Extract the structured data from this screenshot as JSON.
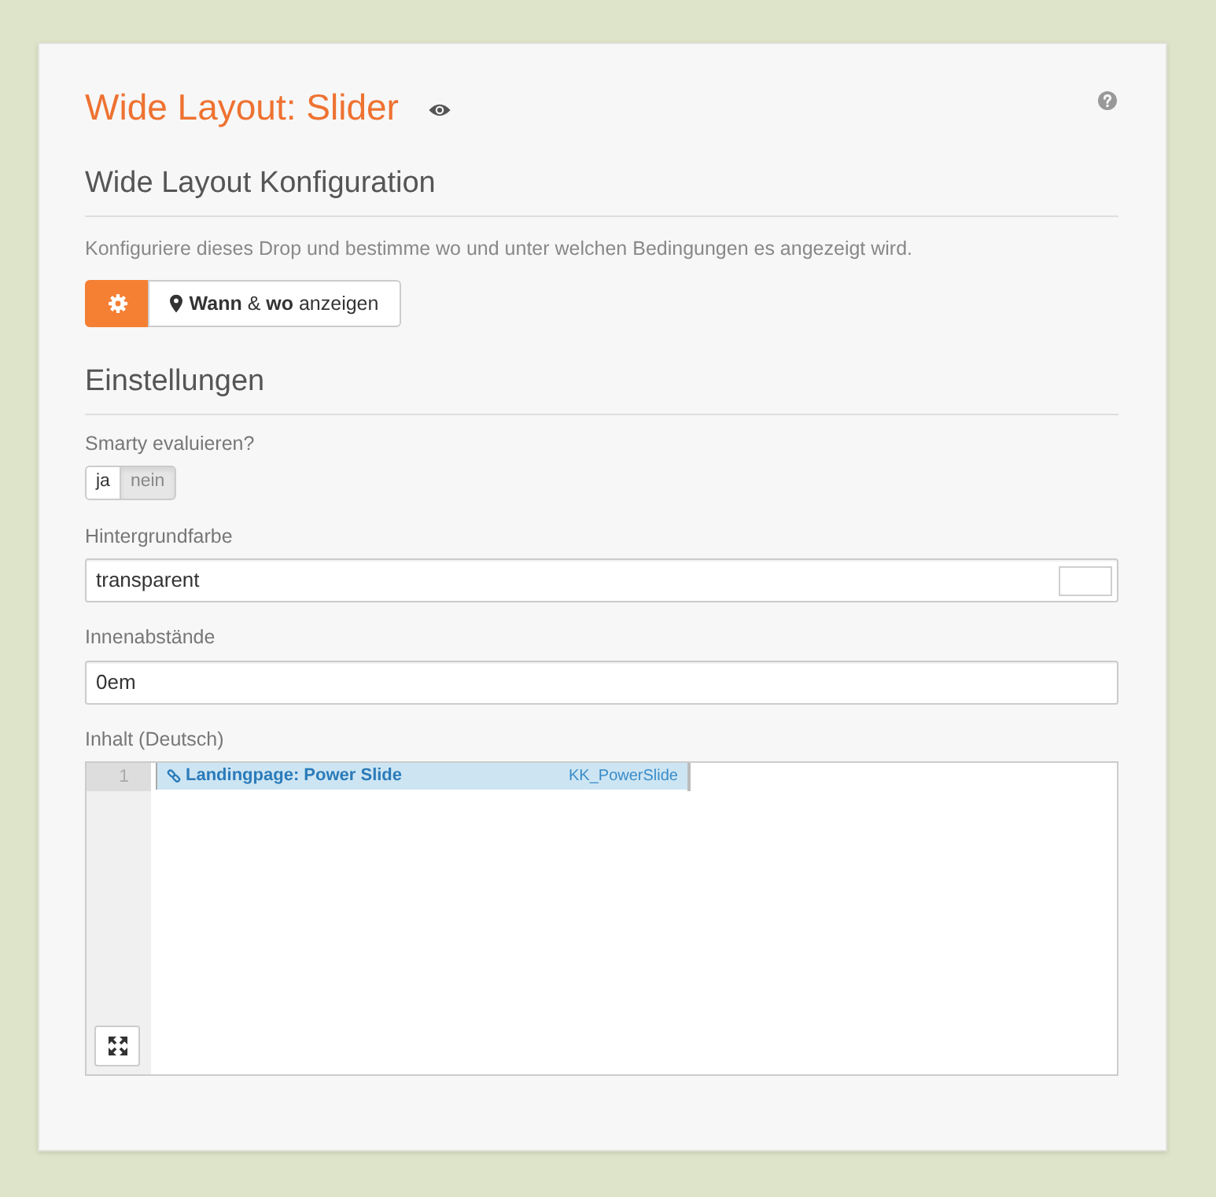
{
  "header": {
    "title": "Wide Layout: Slider"
  },
  "configuration": {
    "heading": "Wide Layout Konfiguration",
    "description": "Konfiguriere dieses Drop und bestimme wo und unter welchen Bedingungen es angezeigt wird.",
    "buttons": [
      {
        "kind": "settings",
        "selected": true
      },
      {
        "kind": "visibility",
        "label": "**Wann** & **wo** anzeigen",
        "selected": false
      }
    ]
  },
  "settings": {
    "heading": "Einstellungen",
    "fields": [
      {
        "kind": "toggle",
        "label": "Smarty evaluieren?",
        "options": [
          {
            "label": "ja",
            "selected": false
          },
          {
            "label": "nein",
            "selected": true
          }
        ]
      },
      {
        "kind": "color",
        "label": "Hintergrundfarbe",
        "value": "transparent"
      },
      {
        "kind": "text",
        "label": "Innenabstände",
        "value": "0em"
      },
      {
        "kind": "editor",
        "label": "Inhalt (Deutsch)",
        "lines": [
          {
            "number": "1",
            "widget": {
              "title": "Landingpage: Power Slide",
              "tag": "KK_PowerSlide"
            }
          }
        ]
      }
    ]
  }
}
